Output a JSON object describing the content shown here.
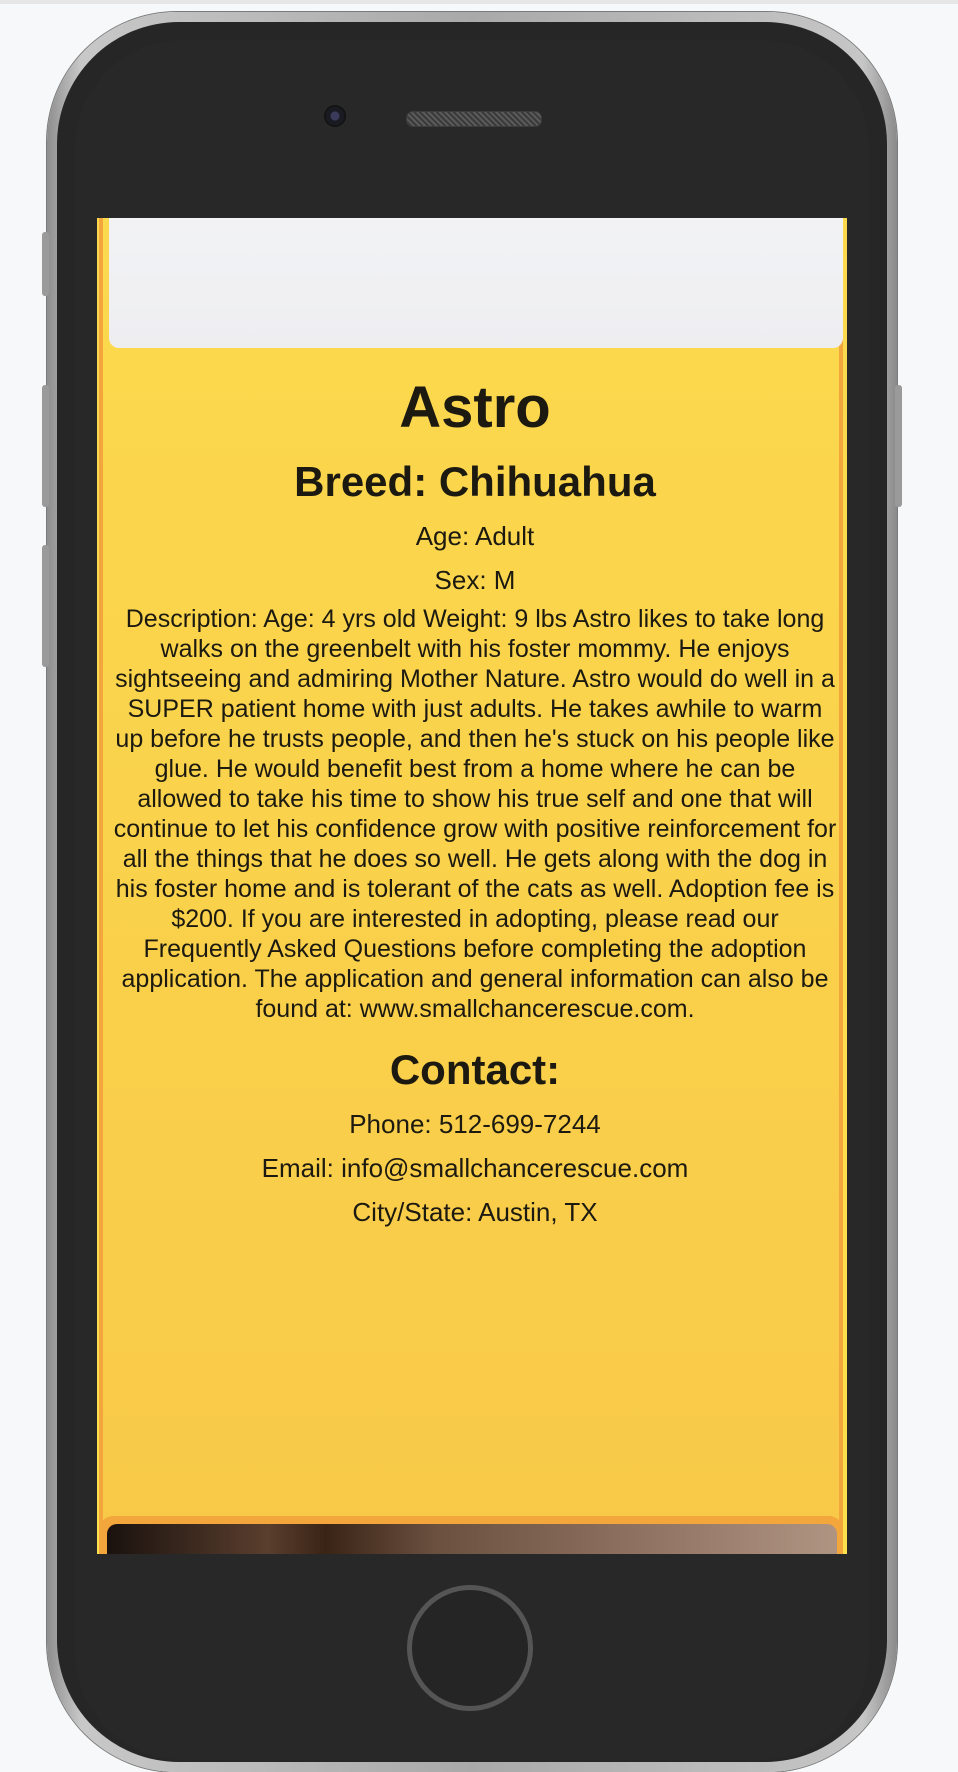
{
  "pet": {
    "name": "Astro",
    "breed": "Breed: Chihuahua",
    "age": "Age: Adult",
    "sex": "Sex: M",
    "description": "Description: Age: 4 yrs old Weight: 9 lbs Astro likes to take long walks on the greenbelt with his foster mommy. He enjoys sightseeing and admiring Mother Nature. Astro would do well in a SUPER patient home with just adults. He takes awhile to warm up before he trusts people, and then he's stuck on his people like glue. He would benefit best from a home where he can be allowed to take his time to show his true self and one that will continue to let his confidence grow with positive reinforcement for all the things that he does so well. He gets along with the dog in his foster home and is tolerant of the cats as well. Adoption fee is $200. If you are interested in adopting, please read our Frequently Asked Questions before completing the adoption application. The application and general information can also be found at: www.smallchancerescue.com."
  },
  "contact": {
    "title": "Contact:",
    "phone": "Phone: 512-699-7244",
    "email": "Email: info@smallchancerescue.com",
    "city_state": "City/State: Austin, TX"
  },
  "colors": {
    "card_bg": "#fbd84e",
    "card_border": "#f2a63c",
    "page_bg": "#fdf654",
    "phone_body": "#262626"
  }
}
